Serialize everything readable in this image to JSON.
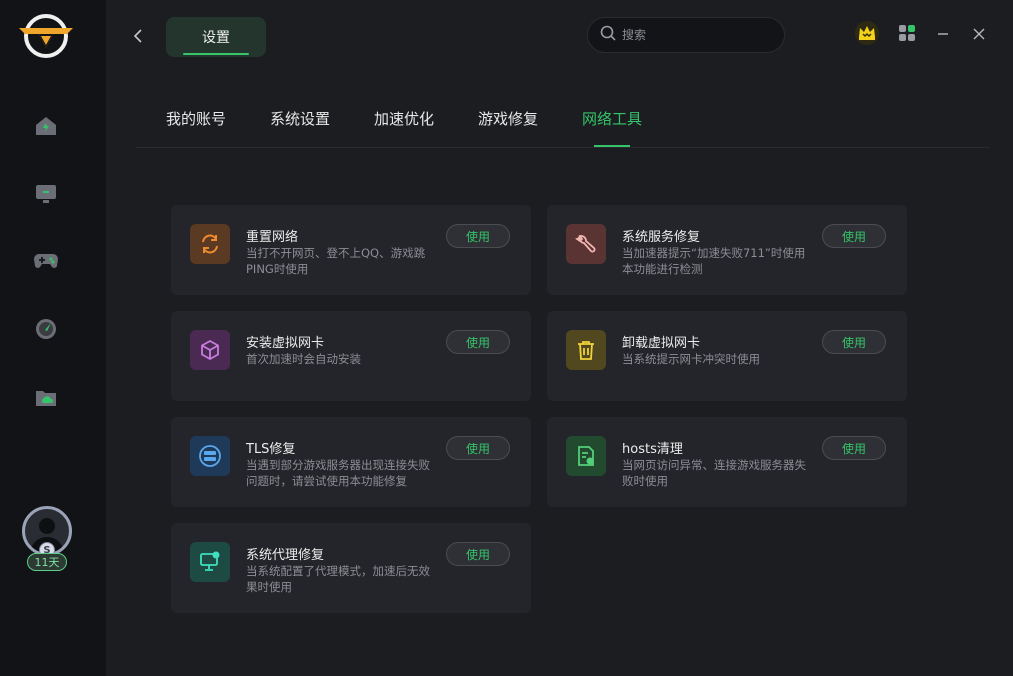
{
  "header": {
    "title": "设置",
    "search_placeholder": "搜索"
  },
  "sidebar": {
    "items": [
      {
        "name": "home-icon"
      },
      {
        "name": "monitor-icon"
      },
      {
        "name": "gamepad-icon"
      },
      {
        "name": "speedometer-icon"
      },
      {
        "name": "cloud-folder-icon"
      }
    ],
    "user": {
      "badge": "11天",
      "coin": "S"
    }
  },
  "tabs": [
    {
      "label": "我的账号"
    },
    {
      "label": "系统设置"
    },
    {
      "label": "加速优化"
    },
    {
      "label": "游戏修复"
    },
    {
      "label": "网络工具",
      "active": true
    }
  ],
  "tools": [
    {
      "title": "重置网络",
      "desc": "当打不开网页、登不上QQ、游戏跳PING时使用",
      "button": "使用",
      "icon": "refresh-icon",
      "icon_bg": "#5a3a22",
      "icon_color": "#f08a2e"
    },
    {
      "title": "系统服务修复",
      "desc": "当加速器提示“加速失败711”时使用本功能进行检测",
      "button": "使用",
      "icon": "wrench-icon",
      "icon_bg": "#5a3433",
      "icon_color": "#f2b6b0"
    },
    {
      "title": "安装虚拟网卡",
      "desc": "首次加速时会自动安装",
      "button": "使用",
      "icon": "cube-icon",
      "icon_bg": "#4a2a52",
      "icon_color": "#c77ce0"
    },
    {
      "title": "卸载虚拟网卡",
      "desc": "当系统提示网卡冲突时使用",
      "button": "使用",
      "icon": "trash-icon",
      "icon_bg": "#52481f",
      "icon_color": "#f0d23a"
    },
    {
      "title": "TLS修复",
      "desc": "当遇到部分游戏服务器出现连接失败问题时，请尝试使用本功能修复",
      "button": "使用",
      "icon": "server-sync-icon",
      "icon_bg": "#1f3a58",
      "icon_color": "#5aa8ef"
    },
    {
      "title": "hosts清理",
      "desc": "当网页访问异常、连接游戏服务器失败时使用",
      "button": "使用",
      "icon": "document-clean-icon",
      "icon_bg": "#224a2e",
      "icon_color": "#52d07a"
    },
    {
      "title": "系统代理修复",
      "desc": "当系统配置了代理模式，加速后无效果时使用",
      "button": "使用",
      "icon": "monitor-repair-icon",
      "icon_bg": "#1e4a44",
      "icon_color": "#3fe0c0"
    }
  ],
  "colors": {
    "accent": "#35c46a",
    "sidebar": "#121317",
    "background": "#1c1d21",
    "card": "#24252a"
  }
}
